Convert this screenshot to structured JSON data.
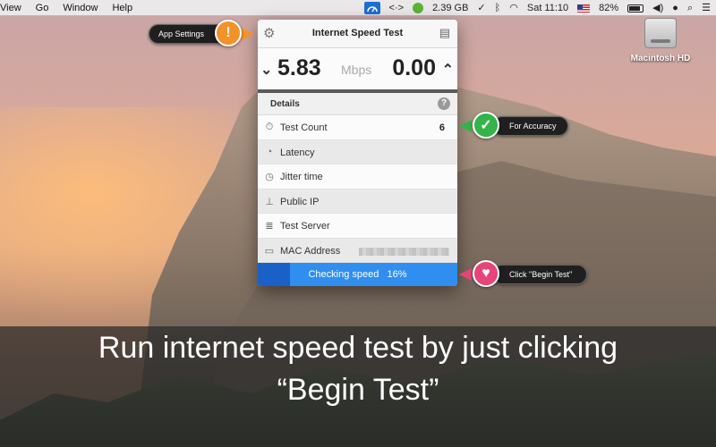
{
  "menubar": {
    "items": [
      "View",
      "Go",
      "Window",
      "Help"
    ],
    "disk_usage": "2.39 GB",
    "clock": "Sat 11:10",
    "battery": "82%"
  },
  "desktop": {
    "disk_label": "Macintosh HD"
  },
  "panel": {
    "title": "Internet Speed Test",
    "download_value": "5.83",
    "unit": "Mbps",
    "upload_value": "0.00",
    "details_label": "Details",
    "help_glyph": "?",
    "rows": [
      {
        "label": "Test Count",
        "value": "6"
      },
      {
        "label": "Latency",
        "value": ""
      },
      {
        "label": "Jitter time",
        "value": ""
      },
      {
        "label": "Public IP",
        "value": ""
      },
      {
        "label": "Test Server",
        "value": ""
      },
      {
        "label": "MAC Address",
        "value": ""
      }
    ],
    "progress_label": "Checking speed",
    "progress_percent_text": "16%",
    "progress": 0.16
  },
  "callouts": {
    "app_settings": "App Settings",
    "for_accuracy": "For Accuracy",
    "begin_test": "Click \"Begin Test\""
  },
  "banner": {
    "line1": "Run internet speed test by just clicking",
    "line2": "“Begin Test”"
  },
  "colors": {
    "accent_blue": "#2f8ef0",
    "settings_badge": "#f4922a",
    "accuracy_badge": "#33b34a",
    "heart_badge": "#e6457a"
  },
  "icons": [
    "gear-icon",
    "history-icon",
    "stopwatch-icon",
    "latency-icon",
    "timer-icon",
    "network-icon",
    "server-icon",
    "monitor-icon",
    "heart-icon",
    "checkmark-icon",
    "exclamation-icon"
  ]
}
